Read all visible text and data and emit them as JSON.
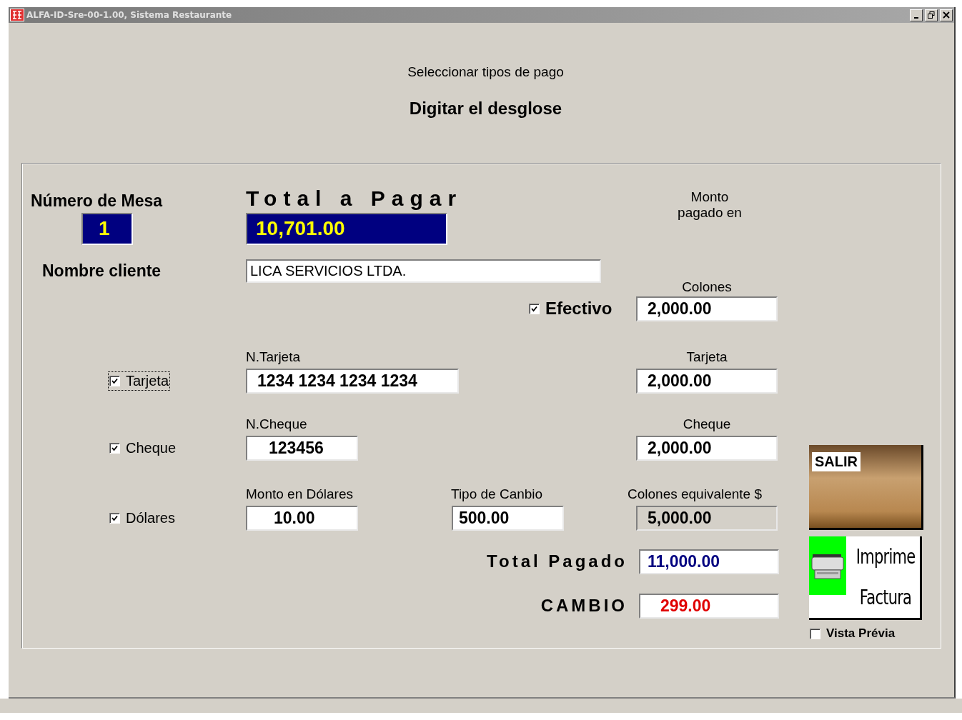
{
  "window": {
    "title": "ALFA-ID-Sre-00-1.00, Sistema Restaurante"
  },
  "header": {
    "instruction": "Seleccionar tipos de pago",
    "subtitle": "Digitar el desglose"
  },
  "form": {
    "table_label": "Número de  Mesa",
    "table_number": "1",
    "total_label": "Total a Pagar",
    "total_value": "10,701.00",
    "paid_in_label": "Monto\npagado en",
    "customer_label": "Nombre cliente",
    "customer_name": "LICA SERVICIOS LTDA.",
    "payments": [
      {
        "kind": "cash",
        "label": "Efectivo",
        "checked": true,
        "focused": false,
        "amount_label": "Colones",
        "amount": "2,000.00",
        "amount_readonly": false
      },
      {
        "kind": "card",
        "label": "Tarjeta",
        "checked": true,
        "focused": true,
        "number_label": "N.Tarjeta",
        "number": "1234 1234 1234 1234",
        "amount_label": "Tarjeta",
        "amount": "2,000.00",
        "amount_readonly": false
      },
      {
        "kind": "check",
        "label": "Cheque",
        "checked": true,
        "focused": false,
        "number_label": "N.Cheque",
        "number": "123456",
        "amount_label": "Cheque",
        "amount": "2,000.00",
        "amount_readonly": false
      },
      {
        "kind": "dollars",
        "label": "Dólares",
        "checked": true,
        "focused": false,
        "usd_label": "Monto en Dólares",
        "usd": "10.00",
        "rate_label": "Tipo de Canbio",
        "rate": "500.00",
        "amount_label": "Colones equivalente $",
        "amount": "5,000.00",
        "amount_readonly": true
      }
    ],
    "total_paid_label": "Total Pagado",
    "total_paid": "11,000.00",
    "change_label": "CAMBIO",
    "change": "299.00"
  },
  "actions": {
    "exit_label": "SALIR",
    "print_label": [
      "Imprime",
      "Factura"
    ],
    "preview": {
      "label": "Vista Prévia",
      "checked": false
    }
  }
}
